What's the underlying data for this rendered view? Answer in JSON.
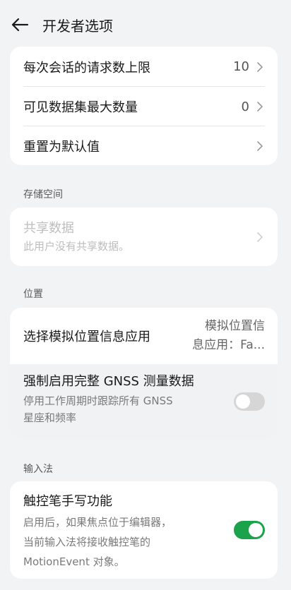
{
  "header": {
    "title": "开发者选项",
    "back_icon": "arrow-left-icon"
  },
  "card1": {
    "rows": [
      {
        "title": "每次会话的请求数上限",
        "value": "10"
      },
      {
        "title": "可见数据集最大数量",
        "value": "0"
      },
      {
        "title": "重置为默认值",
        "value": ""
      }
    ]
  },
  "storage": {
    "label": "存储空间",
    "row": {
      "title": "共享数据",
      "subtitle": "此用户没有共享数据。"
    }
  },
  "location": {
    "label": "位置",
    "mock_app": {
      "title": "选择模拟位置信息应用",
      "value_line1": "模拟位置信",
      "value_line2": "息应用：Fa..."
    },
    "gnss": {
      "title": "强制启用完整 GNSS 测量数据",
      "subtitle_line1": "停用工作周期时跟踪所有 GNSS",
      "subtitle_line2": "星座和频率",
      "enabled": false
    }
  },
  "input": {
    "label": "输入法",
    "stylus": {
      "title": "触控笔手写功能",
      "subtitle_line1": "启用后，如果焦点位于编辑器，",
      "subtitle_line2": "当前输入法将接收触控笔的",
      "subtitle_line3": "MotionEvent 对象。",
      "enabled": true
    }
  },
  "colors": {
    "accent": "#1aa34a",
    "toggle_off": "#d6d6d6",
    "background": "#f1f3f5"
  }
}
